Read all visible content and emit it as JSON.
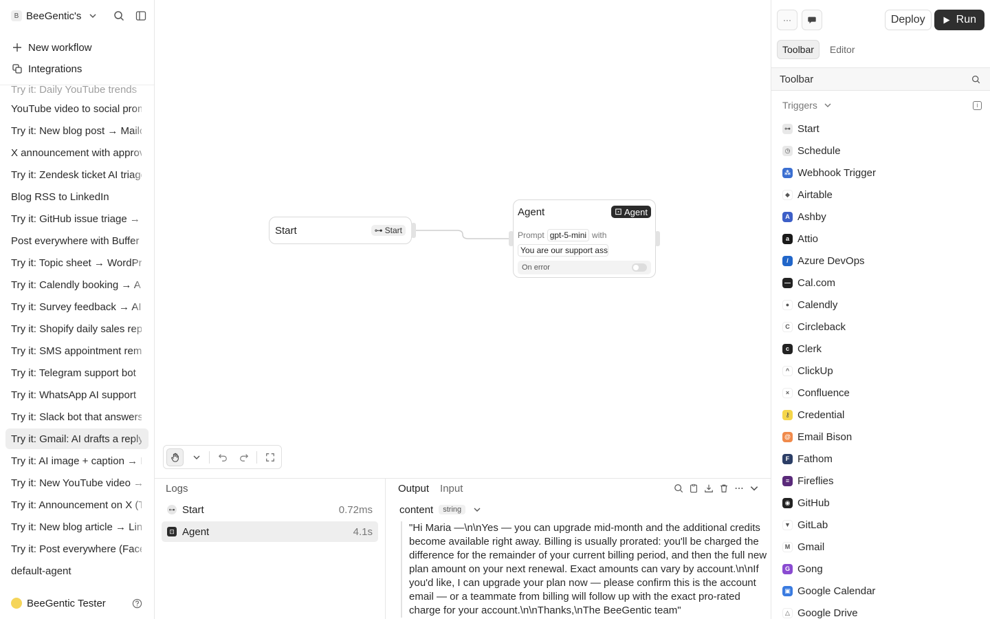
{
  "sidebar": {
    "workspace_initial": "B",
    "workspace_name": "BeeGentic's",
    "new_workflow": "New workflow",
    "integrations": "Integrations",
    "partial_top_item": "Try it: Daily YouTube trends",
    "workflows": [
      "YouTube video to social promo",
      "Try it: New blog post → Mailchimp",
      "X announcement with approval",
      "Try it: Zendesk ticket AI triage",
      "Blog RSS to LinkedIn",
      "Try it: GitHub issue triage → Slack",
      "Post everywhere with Buffer",
      "Try it: Topic sheet → WordPress",
      "Try it: Calendly booking → AI",
      "Try it: Survey feedback → AI summary",
      "Try it: Shopify daily sales report",
      "Try it: SMS appointment reminder",
      "Try it: Telegram support bot",
      "Try it: WhatsApp AI support",
      "Try it: Slack bot that answers",
      "Try it: Gmail: AI drafts a reply",
      "Try it: AI image + caption → Instagram",
      "Try it: New YouTube video → X",
      "Try it: Announcement on X (Twitter)",
      "Try it: New blog article → LinkedIn",
      "Try it: Post everywhere (Facebook)",
      "default-agent"
    ],
    "active_index": 15,
    "user_name": "BeeGentic Tester"
  },
  "canvas": {
    "start_node": {
      "title": "Start",
      "tag": "Start"
    },
    "agent_node": {
      "title": "Agent",
      "tag": "Agent",
      "prompt_label": "Prompt",
      "model": "gpt-5-mini",
      "with_label": "with",
      "prompt_preview": "You are our support assistant",
      "on_error": "On error"
    }
  },
  "logs": {
    "title": "Logs",
    "rows": [
      {
        "name": "Start",
        "duration": "0.72ms"
      },
      {
        "name": "Agent",
        "duration": "4.1s"
      }
    ]
  },
  "output": {
    "tab_output": "Output",
    "tab_input": "Input",
    "field_name": "content",
    "field_type": "string",
    "content": "\"Hi Maria —\\n\\nYes — you can upgrade mid-month and the additional credits become available right away. Billing is usually prorated: you'll be charged the difference for the remainder of your current billing period, and then the full new plan amount on your next renewal. Exact amounts can vary by account.\\n\\nIf you'd like, I can upgrade your plan now — please confirm this is the account email — or a teammate from billing will follow up with the exact pro-rated charge for your account.\\n\\nThanks,\\nThe BeeGentic team\""
  },
  "right_panel": {
    "deploy": "Deploy",
    "run": "Run",
    "more_label": "···",
    "tabs": [
      "Toolbar",
      "Editor"
    ],
    "header": "Toolbar",
    "section": "Triggers",
    "blocks": [
      {
        "name": "Start",
        "color": "#e8e8e8",
        "glyph": "⊶"
      },
      {
        "name": "Schedule",
        "color": "#e8e8e8",
        "glyph": "◷"
      },
      {
        "name": "Webhook Trigger",
        "color": "#3b6fd1",
        "glyph": "⁂"
      },
      {
        "name": "Airtable",
        "color": "#ffffff",
        "glyph": "◆"
      },
      {
        "name": "Ashby",
        "color": "#3d5fc7",
        "glyph": "A"
      },
      {
        "name": "Attio",
        "color": "#1a1a1a",
        "glyph": "a"
      },
      {
        "name": "Azure DevOps",
        "color": "#2166c9",
        "glyph": "/"
      },
      {
        "name": "Cal.com",
        "color": "#222222",
        "glyph": "—"
      },
      {
        "name": "Calendly",
        "color": "#ffffff",
        "glyph": "●"
      },
      {
        "name": "Circleback",
        "color": "#ffffff",
        "glyph": "C"
      },
      {
        "name": "Clerk",
        "color": "#222222",
        "glyph": "c"
      },
      {
        "name": "ClickUp",
        "color": "#ffffff",
        "glyph": "^"
      },
      {
        "name": "Confluence",
        "color": "#ffffff",
        "glyph": "×"
      },
      {
        "name": "Credential",
        "color": "#f5d64a",
        "glyph": "⚷"
      },
      {
        "name": "Email Bison",
        "color": "#f08a4b",
        "glyph": "@"
      },
      {
        "name": "Fathom",
        "color": "#2c3e66",
        "glyph": "F"
      },
      {
        "name": "Fireflies",
        "color": "#5a2a7a",
        "glyph": "≡"
      },
      {
        "name": "GitHub",
        "color": "#222222",
        "glyph": "◉"
      },
      {
        "name": "GitLab",
        "color": "#ffffff",
        "glyph": "▼"
      },
      {
        "name": "Gmail",
        "color": "#ffffff",
        "glyph": "M"
      },
      {
        "name": "Gong",
        "color": "#8a4bd1",
        "glyph": "G"
      },
      {
        "name": "Google Calendar",
        "color": "#3a7be0",
        "glyph": "▣"
      },
      {
        "name": "Google Drive",
        "color": "#ffffff",
        "glyph": "△"
      }
    ]
  }
}
